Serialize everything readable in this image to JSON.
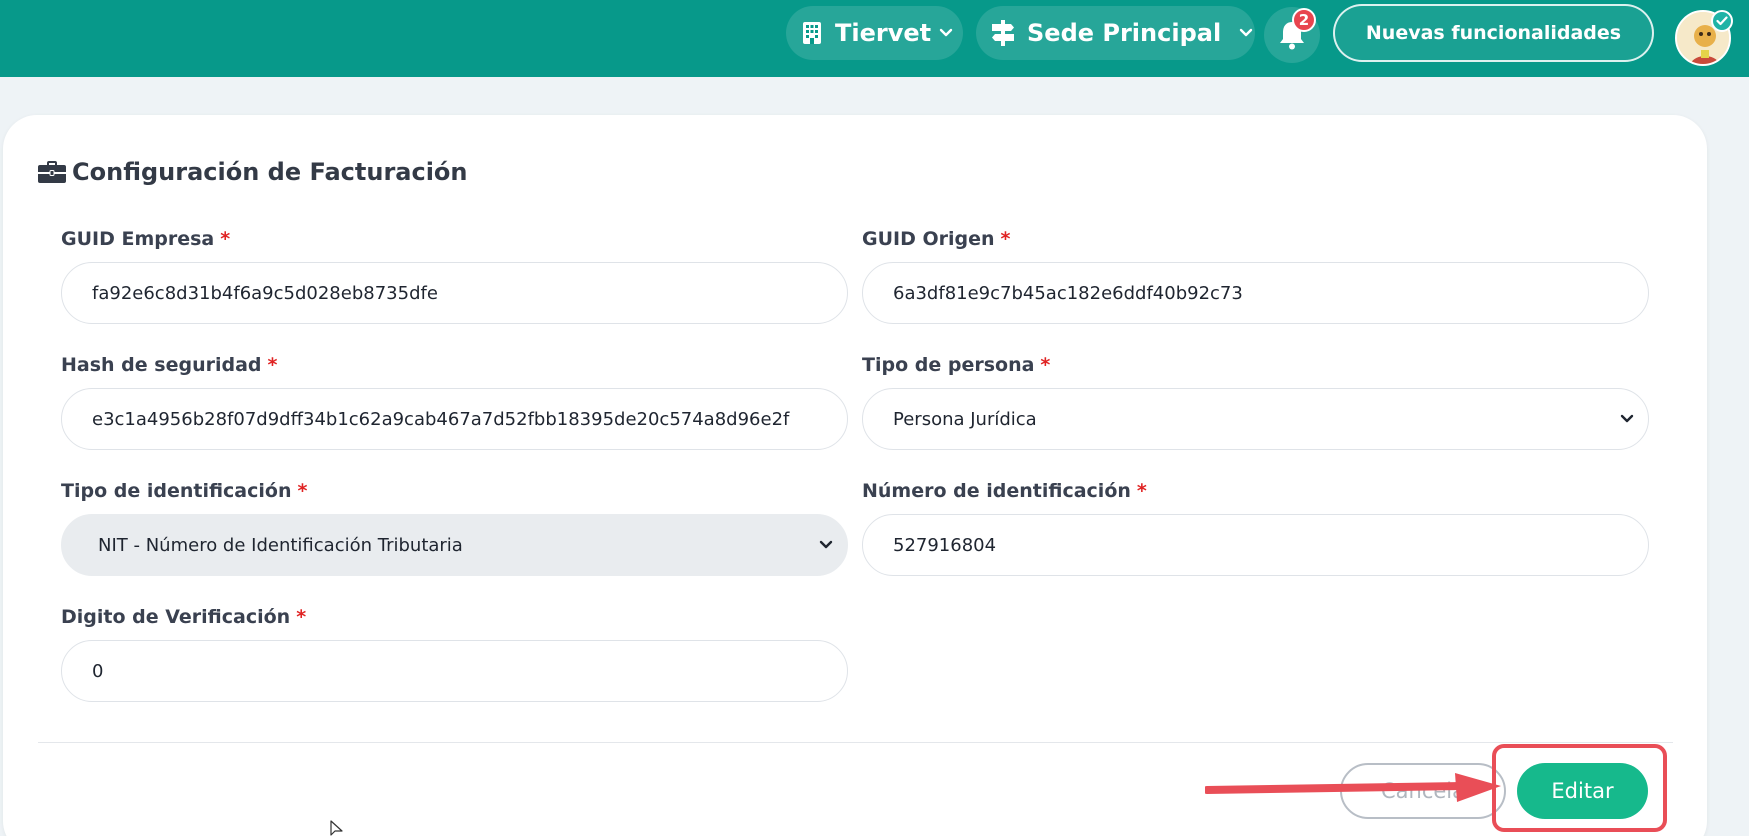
{
  "header": {
    "tenant": "Tiervet",
    "location": "Sede Principal",
    "notifications_count": "2",
    "news_button": "Nuevas funcionalidades",
    "accent_color": "#07998a"
  },
  "card": {
    "title": "Configuración de Facturación",
    "fields": {
      "guid_empresa": {
        "label": "GUID Empresa",
        "required": "*",
        "value": "fa92e6c8d31b4f6a9c5d028eb8735dfe"
      },
      "guid_origen": {
        "label": "GUID Origen",
        "required": "*",
        "value": "6a3df81e9c7b45ac182e6ddf40b92c73"
      },
      "hash_seguridad": {
        "label": "Hash de seguridad",
        "required": "*",
        "value": "e3c1a4956b28f07d9dff34b1c62a9cab467a7d52fbb18395de20c574a8d96e2f"
      },
      "tipo_persona": {
        "label": "Tipo de persona",
        "required": "*",
        "value": "Persona Jurídica"
      },
      "tipo_identificacion": {
        "label": "Tipo de identificación",
        "required": "*",
        "value": "NIT - Número de Identificación Tributaria"
      },
      "numero_identificacion": {
        "label": "Número de identificación",
        "required": "*",
        "value": "527916804"
      },
      "digito_verificacion": {
        "label": "Digito de Verificación",
        "required": "*",
        "value": "0"
      }
    },
    "actions": {
      "cancel": "Cancela",
      "edit": "Editar"
    }
  },
  "colors": {
    "primary_button": "#16b98c",
    "annotation": "#e94e57",
    "required_mark": "#e02424"
  }
}
